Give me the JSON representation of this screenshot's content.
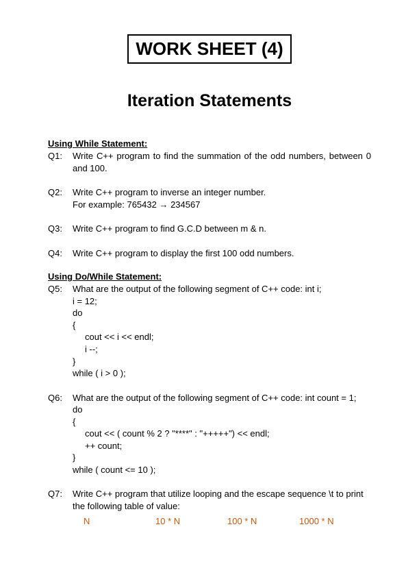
{
  "title": "WORK SHEET (4)",
  "subtitle": "Iteration Statements",
  "section1": {
    "header": "Using While Statement:",
    "q1": {
      "label": "Q1:",
      "text": "Write C++ program to find the summation of the odd numbers, between 0 and 100."
    },
    "q2": {
      "label": "Q2:",
      "line1": "Write C++ program to inverse an integer number.",
      "line2": "For example: 765432  →   234567"
    },
    "q3": {
      "label": "Q3:",
      "text": "Write C++ program to find G.C.D between m & n."
    },
    "q4": {
      "label": "Q4:",
      "text": "Write C++ program to display the first 100 odd numbers."
    }
  },
  "section2": {
    "header": "Using Do/While Statement:",
    "q5": {
      "label": "Q5:",
      "l1": "What are the output of the following segment of C++ code: int i;",
      "l2": "i = 12;",
      "l3": "do",
      "l4": "{",
      "l5": "cout << i << endl;",
      "l6": "i --;",
      "l7": "}",
      "l8": "while ( i > 0 );"
    },
    "q6": {
      "label": "Q6:",
      "l1": "What are the output of the following segment of C++ code: int count = 1;",
      "l2": "do",
      "l3": "{",
      "l4": "cout << ( count % 2 ? \"****\" : \"+++++\") << endl;",
      "l5": "++ count;",
      "l6": "}",
      "l7": "while ( count <= 10 );"
    },
    "q7": {
      "label": "Q7:",
      "text": "Write C++ program that utilize looping and the escape sequence \\t to print the following table of value:",
      "cols": {
        "c1": "N",
        "c2": "10 * N",
        "c3": "100 * N",
        "c4": "1000 * N"
      }
    }
  }
}
